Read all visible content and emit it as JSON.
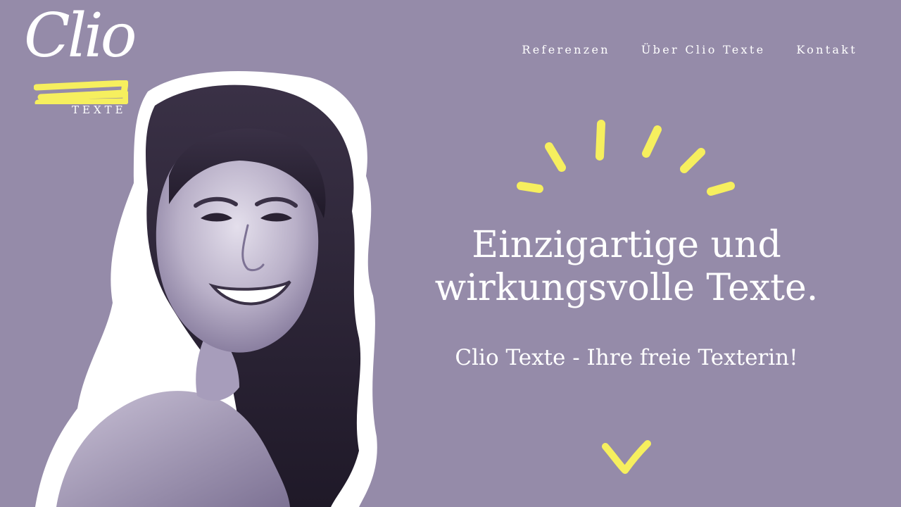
{
  "brand": {
    "logo_script": "Clio",
    "logo_sub": "TEXTE"
  },
  "nav": {
    "items": [
      {
        "label": "Referenzen"
      },
      {
        "label": "Über Clio Texte"
      },
      {
        "label": "Kontakt"
      }
    ]
  },
  "hero": {
    "headline_line1": "Einzigartige und",
    "headline_line2": "wirkungsvolle Texte.",
    "subline": "Clio Texte - Ihre freie Texterin!"
  },
  "colors": {
    "background": "#958ba9",
    "accent": "#f6ef5e",
    "text": "#ffffff"
  },
  "icons": {
    "scroll": "chevron-down-icon",
    "decoration": "sunburst-icon"
  }
}
